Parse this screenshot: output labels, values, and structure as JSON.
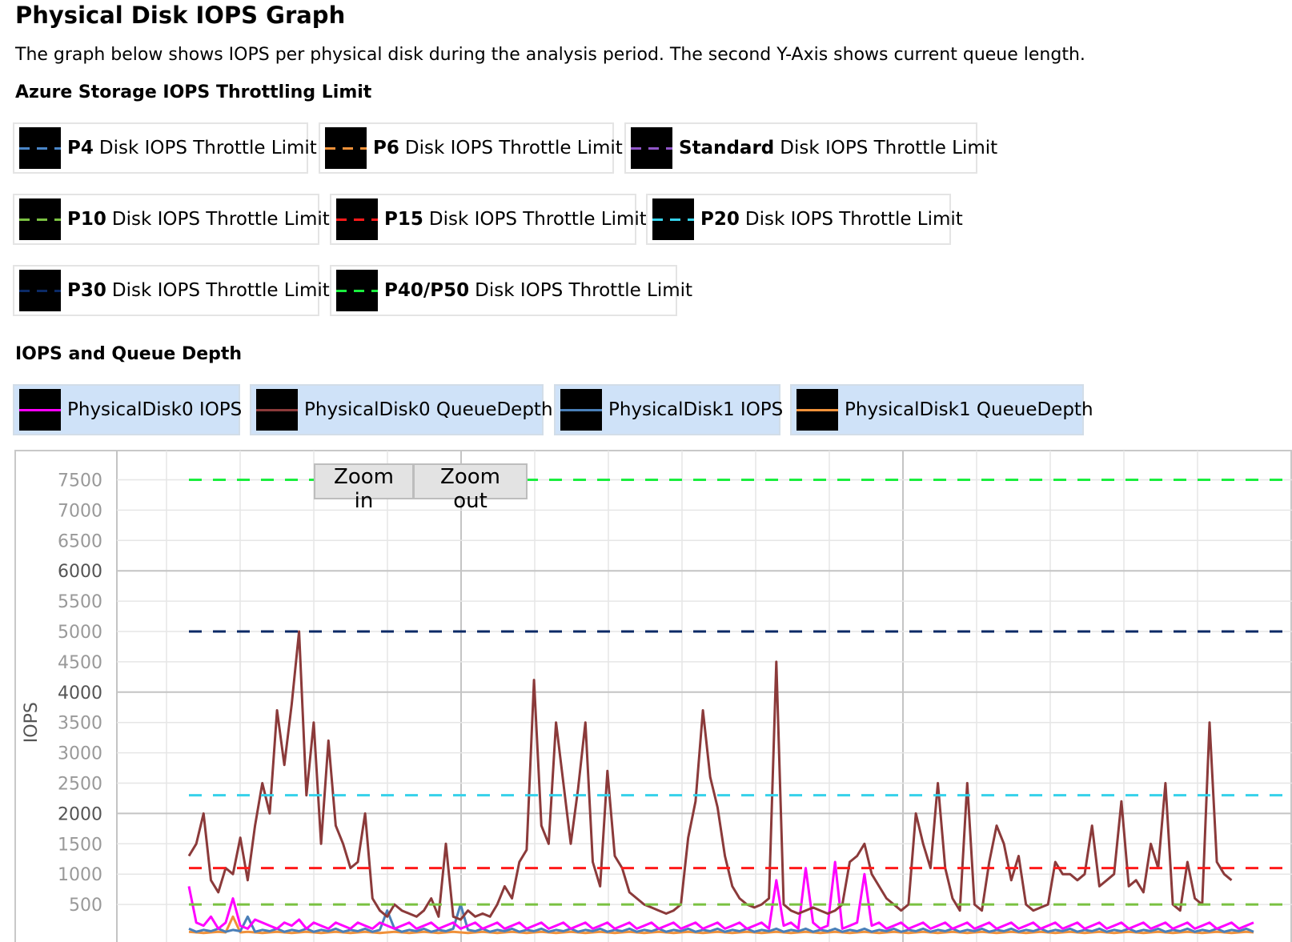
{
  "page": {
    "title": "Physical Disk IOPS Graph",
    "description": "The graph below shows IOPS per physical disk during the analysis period. The second Y-Axis shows current queue length.",
    "throttle_heading": "Azure Storage IOPS Throttling Limit",
    "series_heading": "IOPS and Queue Depth"
  },
  "throttle_legend": [
    {
      "bold": "P4",
      "text": "Disk IOPS Throttle Limit",
      "color": "#4a86c8"
    },
    {
      "bold": "P6",
      "text": "Disk IOPS Throttle Limit",
      "color": "#f0913a"
    },
    {
      "bold": "Standard",
      "text": "Disk IOPS Throttle Limit",
      "color": "#9056c8"
    },
    {
      "bold": "P10",
      "text": "Disk IOPS Throttle Limit",
      "color": "#7ac142"
    },
    {
      "bold": "P15",
      "text": "Disk IOPS Throttle Limit",
      "color": "#ff1a1a"
    },
    {
      "bold": "P20",
      "text": "Disk IOPS Throttle Limit",
      "color": "#36d1ea"
    },
    {
      "bold": "P30",
      "text": "Disk IOPS Throttle Limit",
      "color": "#0b2a66"
    },
    {
      "bold": "P40/P50",
      "text": "Disk IOPS Throttle Limit",
      "color": "#1aee3e"
    }
  ],
  "series_legend": [
    {
      "label": "PhysicalDisk0 IOPS",
      "color": "#ff00ff"
    },
    {
      "label": "PhysicalDisk0 QueueDepth",
      "color": "#8b3a3a"
    },
    {
      "label": "PhysicalDisk1 IOPS",
      "color": "#4a7fb8"
    },
    {
      "label": "PhysicalDisk1 QueueDepth",
      "color": "#f0913a"
    }
  ],
  "controls": {
    "zoom_in": "Zoom in",
    "zoom_out": "Zoom out"
  },
  "chart_data": {
    "type": "line",
    "ylabel": "IOPS",
    "ylim": [
      0,
      7750
    ],
    "yticks": [
      "7500",
      "7000",
      "6500",
      "6000",
      "5500",
      "5000",
      "4500",
      "4000",
      "3500",
      "3000",
      "2500",
      "2000",
      "1500",
      "1000",
      "500"
    ],
    "grid": true,
    "threshold_lines": [
      {
        "name": "P40/P50",
        "value": 7500,
        "color": "#1aee3e"
      },
      {
        "name": "P30",
        "value": 5000,
        "color": "#0b2a66"
      },
      {
        "name": "P20",
        "value": 2300,
        "color": "#36d1ea"
      },
      {
        "name": "P15",
        "value": 1100,
        "color": "#ff1a1a"
      },
      {
        "name": "P10",
        "value": 500,
        "color": "#7ac142"
      }
    ],
    "x_points": 146,
    "series": [
      {
        "name": "PhysicalDisk0 QueueDepth",
        "color": "#8b3a3a",
        "values": [
          1300,
          1500,
          2000,
          900,
          700,
          1100,
          1000,
          1600,
          900,
          1800,
          2500,
          2000,
          3700,
          2800,
          3800,
          5000,
          2300,
          3500,
          1500,
          3200,
          1800,
          1500,
          1100,
          1200,
          2000,
          600,
          400,
          300,
          500,
          400,
          350,
          300,
          400,
          600,
          300,
          1500,
          300,
          250,
          400,
          300,
          350,
          300,
          500,
          800,
          600,
          1200,
          1400,
          4200,
          1800,
          1500,
          3500,
          2500,
          1500,
          2400,
          3500,
          1200,
          800,
          2700,
          1300,
          1100,
          700,
          600,
          500,
          450,
          400,
          350,
          400,
          500,
          1600,
          2200,
          3700,
          2600,
          2100,
          1300,
          800,
          600,
          500,
          450,
          500,
          600,
          4500,
          500,
          400,
          350,
          400,
          450,
          400,
          350,
          400,
          500,
          1200,
          1300,
          1500,
          1000,
          800,
          600,
          500,
          400,
          500,
          2000,
          1500,
          1100,
          2500,
          1100,
          600,
          400,
          2500,
          500,
          400,
          1200,
          1800,
          1500,
          900,
          1300,
          500,
          400,
          450,
          500,
          1200,
          1000,
          1000,
          900,
          1000,
          1800,
          800,
          900,
          1000,
          2200,
          800,
          900,
          700,
          1500,
          1100,
          2500,
          500,
          400,
          1200,
          600,
          500,
          3500,
          1200,
          1000,
          900
        ]
      },
      {
        "name": "PhysicalDisk0 IOPS",
        "color": "#ff00ff",
        "values": [
          800,
          200,
          150,
          300,
          100,
          200,
          600,
          150,
          100,
          250,
          200,
          150,
          100,
          200,
          150,
          250,
          100,
          200,
          150,
          100,
          200,
          150,
          100,
          200,
          150,
          100,
          200,
          150,
          100,
          150,
          200,
          100,
          150,
          200,
          100,
          150,
          200,
          100,
          150,
          200,
          100,
          150,
          200,
          100,
          150,
          200,
          100,
          150,
          200,
          100,
          150,
          200,
          100,
          150,
          200,
          100,
          150,
          200,
          100,
          150,
          200,
          100,
          150,
          200,
          100,
          150,
          200,
          100,
          150,
          200,
          100,
          150,
          200,
          100,
          150,
          200,
          100,
          150,
          200,
          100,
          900,
          150,
          200,
          100,
          1100,
          200,
          100,
          150,
          1200,
          100,
          150,
          200,
          1000,
          150,
          200,
          100,
          150,
          200,
          100,
          150,
          200,
          100,
          150,
          200,
          100,
          150,
          200,
          100,
          150,
          200,
          100,
          150,
          200,
          100,
          150,
          200,
          100,
          150,
          200,
          100,
          150,
          200,
          100,
          150,
          200,
          100,
          150,
          200,
          100,
          150,
          200,
          100,
          150,
          200,
          100,
          150,
          200,
          100,
          150,
          200,
          100,
          150,
          200,
          100,
          150,
          200
        ]
      },
      {
        "name": "PhysicalDisk1 IOPS",
        "color": "#4a7fb8",
        "values": [
          100,
          50,
          80,
          60,
          100,
          50,
          80,
          60,
          300,
          50,
          80,
          60,
          100,
          50,
          80,
          60,
          100,
          50,
          80,
          60,
          100,
          50,
          80,
          60,
          100,
          50,
          80,
          400,
          100,
          50,
          80,
          60,
          100,
          50,
          80,
          60,
          100,
          500,
          80,
          60,
          100,
          50,
          80,
          60,
          100,
          50,
          80,
          60,
          100,
          50,
          80,
          60,
          100,
          50,
          80,
          60,
          100,
          50,
          80,
          60,
          100,
          50,
          80,
          60,
          100,
          50,
          80,
          60,
          100,
          50,
          80,
          60,
          100,
          50,
          80,
          60,
          100,
          50,
          80,
          60,
          100,
          50,
          80,
          60,
          100,
          50,
          80,
          60,
          100,
          50,
          80,
          60,
          100,
          50,
          80,
          60,
          100,
          50,
          80,
          60,
          100,
          50,
          80,
          60,
          100,
          50,
          80,
          60,
          100,
          50,
          80,
          60,
          100,
          50,
          80,
          60,
          100,
          50,
          80,
          60,
          100,
          50,
          80,
          60,
          100,
          50,
          80,
          60,
          100,
          50,
          80,
          60,
          100,
          50,
          80,
          60,
          100,
          50,
          80,
          60,
          100,
          50,
          80,
          60,
          100,
          50
        ]
      },
      {
        "name": "PhysicalDisk1 QueueDepth",
        "color": "#f0913a",
        "values": [
          50,
          40,
          30,
          40,
          50,
          40,
          300,
          40,
          50,
          40,
          30,
          40,
          50,
          40,
          30,
          40,
          50,
          40,
          30,
          40,
          50,
          40,
          30,
          40,
          50,
          40,
          30,
          40,
          50,
          40,
          30,
          40,
          50,
          40,
          30,
          40,
          50,
          40,
          30,
          40,
          50,
          40,
          30,
          40,
          50,
          40,
          30,
          40,
          50,
          40,
          30,
          40,
          50,
          40,
          30,
          40,
          50,
          40,
          30,
          40,
          50,
          40,
          30,
          40,
          50,
          40,
          30,
          40,
          50,
          40,
          30,
          40,
          50,
          40,
          30,
          40,
          50,
          40,
          30,
          40,
          50,
          40,
          30,
          40,
          50,
          40,
          30,
          40,
          50,
          40,
          30,
          40,
          50,
          40,
          30,
          40,
          50,
          40,
          30,
          40,
          50,
          40,
          30,
          40,
          50,
          40,
          30,
          40,
          50,
          40,
          30,
          40,
          50,
          40,
          30,
          40,
          50,
          40,
          30,
          40,
          50,
          40,
          30,
          40,
          50,
          40,
          30,
          40,
          50,
          40,
          30,
          40,
          50,
          40,
          30,
          40,
          50,
          40,
          30,
          40,
          50,
          40,
          30,
          40,
          50,
          40
        ]
      }
    ]
  }
}
